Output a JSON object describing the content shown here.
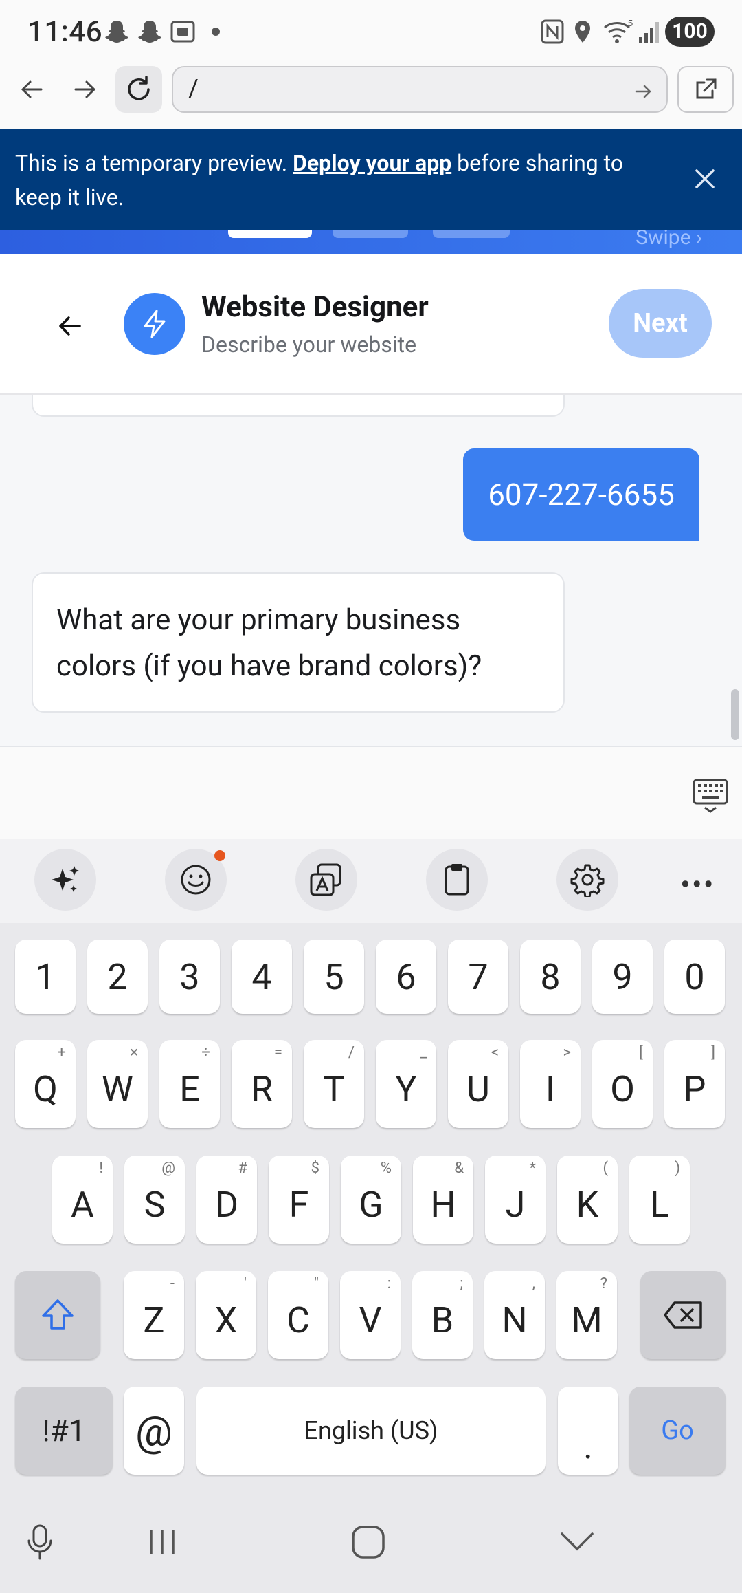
{
  "status_bar": {
    "time": "11:46",
    "battery": "100",
    "wifi_label": "5"
  },
  "browser": {
    "url": "/"
  },
  "banner": {
    "text_before": "This is a temporary preview. ",
    "link": "Deploy your app",
    "text_after": " before sharing to keep it live.",
    "swipe_hint": "Swipe ›"
  },
  "header": {
    "title": "Website Designer",
    "subtitle": "Describe your website",
    "next_label": "Next"
  },
  "chat": {
    "user_message": "607-227-6655",
    "bot_message": "What are your primary business colors (if you have brand colors)?"
  },
  "keyboard": {
    "number_row": [
      "1",
      "2",
      "3",
      "4",
      "5",
      "6",
      "7",
      "8",
      "9",
      "0"
    ],
    "row1": [
      {
        "key": "Q",
        "alt": "+"
      },
      {
        "key": "W",
        "alt": "×"
      },
      {
        "key": "E",
        "alt": "÷"
      },
      {
        "key": "R",
        "alt": "="
      },
      {
        "key": "T",
        "alt": "/"
      },
      {
        "key": "Y",
        "alt": "_"
      },
      {
        "key": "U",
        "alt": "<"
      },
      {
        "key": "I",
        "alt": ">"
      },
      {
        "key": "O",
        "alt": "["
      },
      {
        "key": "P",
        "alt": "]"
      }
    ],
    "row2": [
      {
        "key": "A",
        "alt": "!"
      },
      {
        "key": "S",
        "alt": "@"
      },
      {
        "key": "D",
        "alt": "#"
      },
      {
        "key": "F",
        "alt": "$"
      },
      {
        "key": "G",
        "alt": "%"
      },
      {
        "key": "H",
        "alt": "&"
      },
      {
        "key": "J",
        "alt": "*"
      },
      {
        "key": "K",
        "alt": "("
      },
      {
        "key": "L",
        "alt": ")"
      }
    ],
    "row3": [
      {
        "key": "Z",
        "alt": "-"
      },
      {
        "key": "X",
        "alt": "'"
      },
      {
        "key": "C",
        "alt": "\""
      },
      {
        "key": "V",
        "alt": ":"
      },
      {
        "key": "B",
        "alt": ";"
      },
      {
        "key": "N",
        "alt": ","
      },
      {
        "key": "M",
        "alt": "?"
      }
    ],
    "symbols_label": "!#1",
    "at_label": "@",
    "space_label": "English (US)",
    "period_label": ".",
    "go_label": "Go"
  }
}
